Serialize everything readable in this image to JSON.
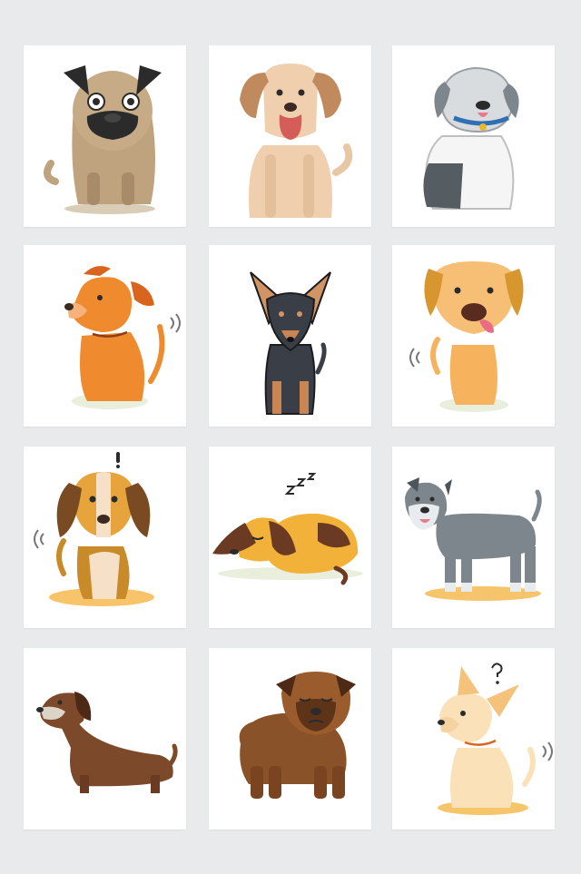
{
  "colors": {
    "page_background": "#e9eaec",
    "card_background": "#ffffff"
  },
  "cards": [
    {
      "icon": "pug-icon"
    },
    {
      "icon": "labrador-icon"
    },
    {
      "icon": "sheepdog-icon"
    },
    {
      "icon": "orange-dog-icon"
    },
    {
      "icon": "pinscher-icon"
    },
    {
      "icon": "beagle-icon"
    },
    {
      "icon": "surprised-beagle-icon"
    },
    {
      "icon": "sleeping-hound-icon"
    },
    {
      "icon": "schnauzer-icon"
    },
    {
      "icon": "dachshund-icon"
    },
    {
      "icon": "brown-pug-icon"
    },
    {
      "icon": "chihuahua-icon"
    }
  ]
}
